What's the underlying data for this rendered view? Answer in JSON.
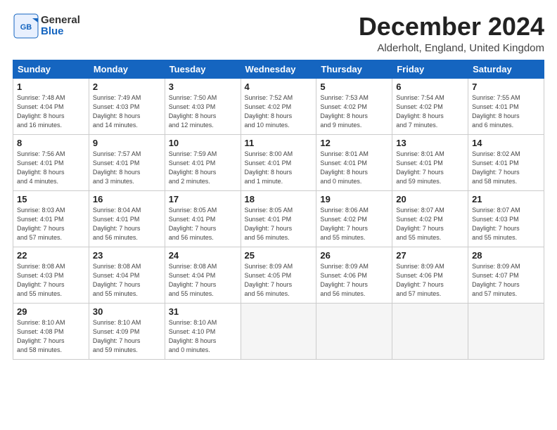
{
  "header": {
    "logo_general": "General",
    "logo_blue": "Blue",
    "month_title": "December 2024",
    "location": "Alderholt, England, United Kingdom"
  },
  "weekdays": [
    "Sunday",
    "Monday",
    "Tuesday",
    "Wednesday",
    "Thursday",
    "Friday",
    "Saturday"
  ],
  "weeks": [
    [
      {
        "day": "1",
        "info": "Sunrise: 7:48 AM\nSunset: 4:04 PM\nDaylight: 8 hours\nand 16 minutes."
      },
      {
        "day": "2",
        "info": "Sunrise: 7:49 AM\nSunset: 4:03 PM\nDaylight: 8 hours\nand 14 minutes."
      },
      {
        "day": "3",
        "info": "Sunrise: 7:50 AM\nSunset: 4:03 PM\nDaylight: 8 hours\nand 12 minutes."
      },
      {
        "day": "4",
        "info": "Sunrise: 7:52 AM\nSunset: 4:02 PM\nDaylight: 8 hours\nand 10 minutes."
      },
      {
        "day": "5",
        "info": "Sunrise: 7:53 AM\nSunset: 4:02 PM\nDaylight: 8 hours\nand 9 minutes."
      },
      {
        "day": "6",
        "info": "Sunrise: 7:54 AM\nSunset: 4:02 PM\nDaylight: 8 hours\nand 7 minutes."
      },
      {
        "day": "7",
        "info": "Sunrise: 7:55 AM\nSunset: 4:01 PM\nDaylight: 8 hours\nand 6 minutes."
      }
    ],
    [
      {
        "day": "8",
        "info": "Sunrise: 7:56 AM\nSunset: 4:01 PM\nDaylight: 8 hours\nand 4 minutes."
      },
      {
        "day": "9",
        "info": "Sunrise: 7:57 AM\nSunset: 4:01 PM\nDaylight: 8 hours\nand 3 minutes."
      },
      {
        "day": "10",
        "info": "Sunrise: 7:59 AM\nSunset: 4:01 PM\nDaylight: 8 hours\nand 2 minutes."
      },
      {
        "day": "11",
        "info": "Sunrise: 8:00 AM\nSunset: 4:01 PM\nDaylight: 8 hours\nand 1 minute."
      },
      {
        "day": "12",
        "info": "Sunrise: 8:01 AM\nSunset: 4:01 PM\nDaylight: 8 hours\nand 0 minutes."
      },
      {
        "day": "13",
        "info": "Sunrise: 8:01 AM\nSunset: 4:01 PM\nDaylight: 7 hours\nand 59 minutes."
      },
      {
        "day": "14",
        "info": "Sunrise: 8:02 AM\nSunset: 4:01 PM\nDaylight: 7 hours\nand 58 minutes."
      }
    ],
    [
      {
        "day": "15",
        "info": "Sunrise: 8:03 AM\nSunset: 4:01 PM\nDaylight: 7 hours\nand 57 minutes."
      },
      {
        "day": "16",
        "info": "Sunrise: 8:04 AM\nSunset: 4:01 PM\nDaylight: 7 hours\nand 56 minutes."
      },
      {
        "day": "17",
        "info": "Sunrise: 8:05 AM\nSunset: 4:01 PM\nDaylight: 7 hours\nand 56 minutes."
      },
      {
        "day": "18",
        "info": "Sunrise: 8:05 AM\nSunset: 4:01 PM\nDaylight: 7 hours\nand 56 minutes."
      },
      {
        "day": "19",
        "info": "Sunrise: 8:06 AM\nSunset: 4:02 PM\nDaylight: 7 hours\nand 55 minutes."
      },
      {
        "day": "20",
        "info": "Sunrise: 8:07 AM\nSunset: 4:02 PM\nDaylight: 7 hours\nand 55 minutes."
      },
      {
        "day": "21",
        "info": "Sunrise: 8:07 AM\nSunset: 4:03 PM\nDaylight: 7 hours\nand 55 minutes."
      }
    ],
    [
      {
        "day": "22",
        "info": "Sunrise: 8:08 AM\nSunset: 4:03 PM\nDaylight: 7 hours\nand 55 minutes."
      },
      {
        "day": "23",
        "info": "Sunrise: 8:08 AM\nSunset: 4:04 PM\nDaylight: 7 hours\nand 55 minutes."
      },
      {
        "day": "24",
        "info": "Sunrise: 8:08 AM\nSunset: 4:04 PM\nDaylight: 7 hours\nand 55 minutes."
      },
      {
        "day": "25",
        "info": "Sunrise: 8:09 AM\nSunset: 4:05 PM\nDaylight: 7 hours\nand 56 minutes."
      },
      {
        "day": "26",
        "info": "Sunrise: 8:09 AM\nSunset: 4:06 PM\nDaylight: 7 hours\nand 56 minutes."
      },
      {
        "day": "27",
        "info": "Sunrise: 8:09 AM\nSunset: 4:06 PM\nDaylight: 7 hours\nand 57 minutes."
      },
      {
        "day": "28",
        "info": "Sunrise: 8:09 AM\nSunset: 4:07 PM\nDaylight: 7 hours\nand 57 minutes."
      }
    ],
    [
      {
        "day": "29",
        "info": "Sunrise: 8:10 AM\nSunset: 4:08 PM\nDaylight: 7 hours\nand 58 minutes."
      },
      {
        "day": "30",
        "info": "Sunrise: 8:10 AM\nSunset: 4:09 PM\nDaylight: 7 hours\nand 59 minutes."
      },
      {
        "day": "31",
        "info": "Sunrise: 8:10 AM\nSunset: 4:10 PM\nDaylight: 8 hours\nand 0 minutes."
      },
      null,
      null,
      null,
      null
    ]
  ]
}
